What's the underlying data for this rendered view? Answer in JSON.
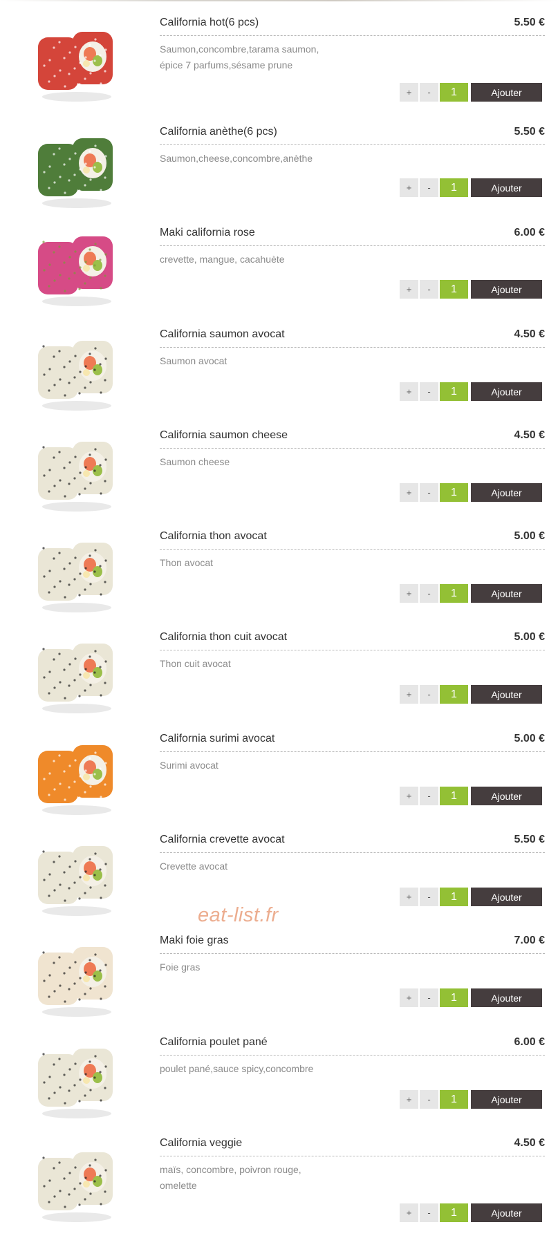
{
  "menu": {
    "add_label": "Ajouter",
    "plus_label": "+",
    "minus_label": "-",
    "items": [
      {
        "name": "California hot(6 pcs)",
        "price": "5.50 €",
        "desc": "Saumon,concombre,tarama saumon, épice 7 parfums,sésame prune",
        "qty": "1",
        "roll_color": "#d4453a",
        "coat": "red"
      },
      {
        "name": "California anèthe(6 pcs)",
        "price": "5.50 €",
        "desc": "Saumon,cheese,concombre,anèthe",
        "qty": "1",
        "roll_color": "#4f7d3a",
        "coat": "green"
      },
      {
        "name": "Maki california rose",
        "price": "6.00 €",
        "desc": "crevette, mangue, cacahuète",
        "qty": "1",
        "roll_color": "#d64b86",
        "coat": "pink"
      },
      {
        "name": "California saumon avocat",
        "price": "4.50 €",
        "desc": "Saumon avocat",
        "qty": "1",
        "roll_color": "#eae6d6",
        "coat": "rice"
      },
      {
        "name": "California saumon cheese",
        "price": "4.50 €",
        "desc": "Saumon cheese",
        "qty": "1",
        "roll_color": "#eae6d6",
        "coat": "rice"
      },
      {
        "name": "California thon avocat",
        "price": "5.00 €",
        "desc": "Thon avocat",
        "qty": "1",
        "roll_color": "#eae6d6",
        "coat": "rice"
      },
      {
        "name": "California thon cuit avocat",
        "price": "5.00 €",
        "desc": "Thon cuit avocat",
        "qty": "1",
        "roll_color": "#eae6d6",
        "coat": "rice"
      },
      {
        "name": "California surimi avocat",
        "price": "5.00 €",
        "desc": "Surimi avocat",
        "qty": "1",
        "roll_color": "#ef8a2a",
        "coat": "orange"
      },
      {
        "name": "California crevette avocat",
        "price": "5.50 €",
        "desc": "Crevette avocat",
        "qty": "1",
        "roll_color": "#eae6d6",
        "coat": "rice"
      },
      {
        "name": "Maki foie gras",
        "price": "7.00 €",
        "desc": "Foie gras",
        "qty": "1",
        "roll_color": "#f0e4d0",
        "coat": "rice"
      },
      {
        "name": "California poulet pané",
        "price": "6.00 €",
        "desc": "poulet pané,sauce spicy,concombre",
        "qty": "1",
        "roll_color": "#eae6d6",
        "coat": "rice"
      },
      {
        "name": "California veggie",
        "price": "4.50 €",
        "desc": "maïs, concombre, poivron rouge, omelette",
        "qty": "1",
        "roll_color": "#eae6d6",
        "coat": "rice"
      }
    ]
  },
  "watermark": "eat-list.fr",
  "colors": {
    "accent_green": "#93c035",
    "button_dark": "#453d3e",
    "watermark": "#eca98a"
  }
}
